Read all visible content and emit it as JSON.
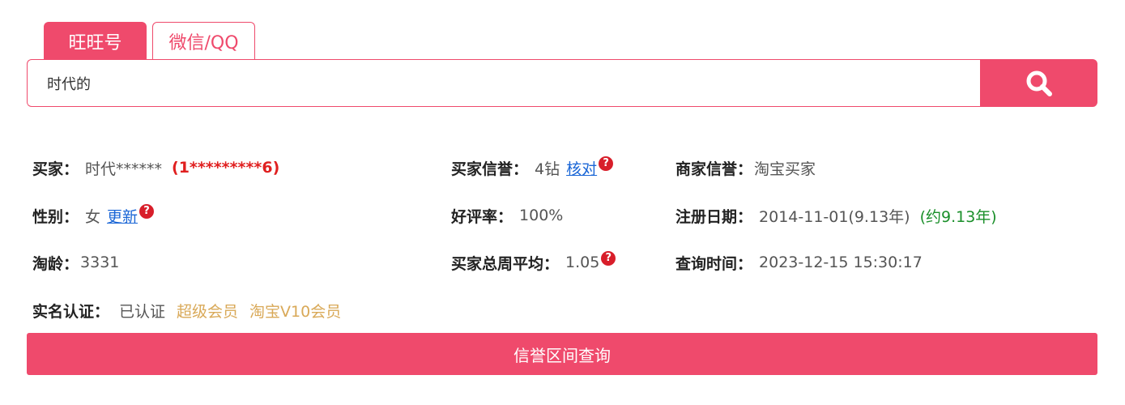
{
  "tabs": [
    {
      "label": "旺旺号",
      "active": true
    },
    {
      "label": "微信/QQ",
      "active": false
    }
  ],
  "search": {
    "value": "时代的",
    "icon": "search-icon"
  },
  "info": {
    "buyer": {
      "label": "买家：",
      "value": "时代******",
      "masked_phone": "(1*********6)"
    },
    "buyer_credit": {
      "label": "买家信誉：",
      "value": "4钻",
      "link": "核对"
    },
    "seller_credit": {
      "label": "商家信誉：",
      "value": "淘宝买家"
    },
    "gender": {
      "label": "性别：",
      "value": "女",
      "link": "更新"
    },
    "good_rate": {
      "label": "好评率：",
      "value": "100%"
    },
    "reg_date": {
      "label": "注册日期：",
      "value": "2014-11-01(9.13年)",
      "approx": "(约9.13年)"
    },
    "taobao_age": {
      "label": "淘龄：",
      "value": "3331"
    },
    "weekly_avg": {
      "label": "买家总周平均：",
      "value": "1.05"
    },
    "query_time": {
      "label": "查询时间：",
      "value": "2023-12-15 15:30:17"
    },
    "real_name": {
      "label": "实名认证：",
      "value": "已认证",
      "badge1": "超级会员",
      "badge2": "淘宝V10会员"
    }
  },
  "range_button": {
    "label": "信誉区间查询"
  },
  "colors": {
    "accent": "#ef4a6c",
    "masked": "#e02020",
    "link": "#1a66d6",
    "green": "#1a8f2a",
    "gold": "#d9a958"
  }
}
